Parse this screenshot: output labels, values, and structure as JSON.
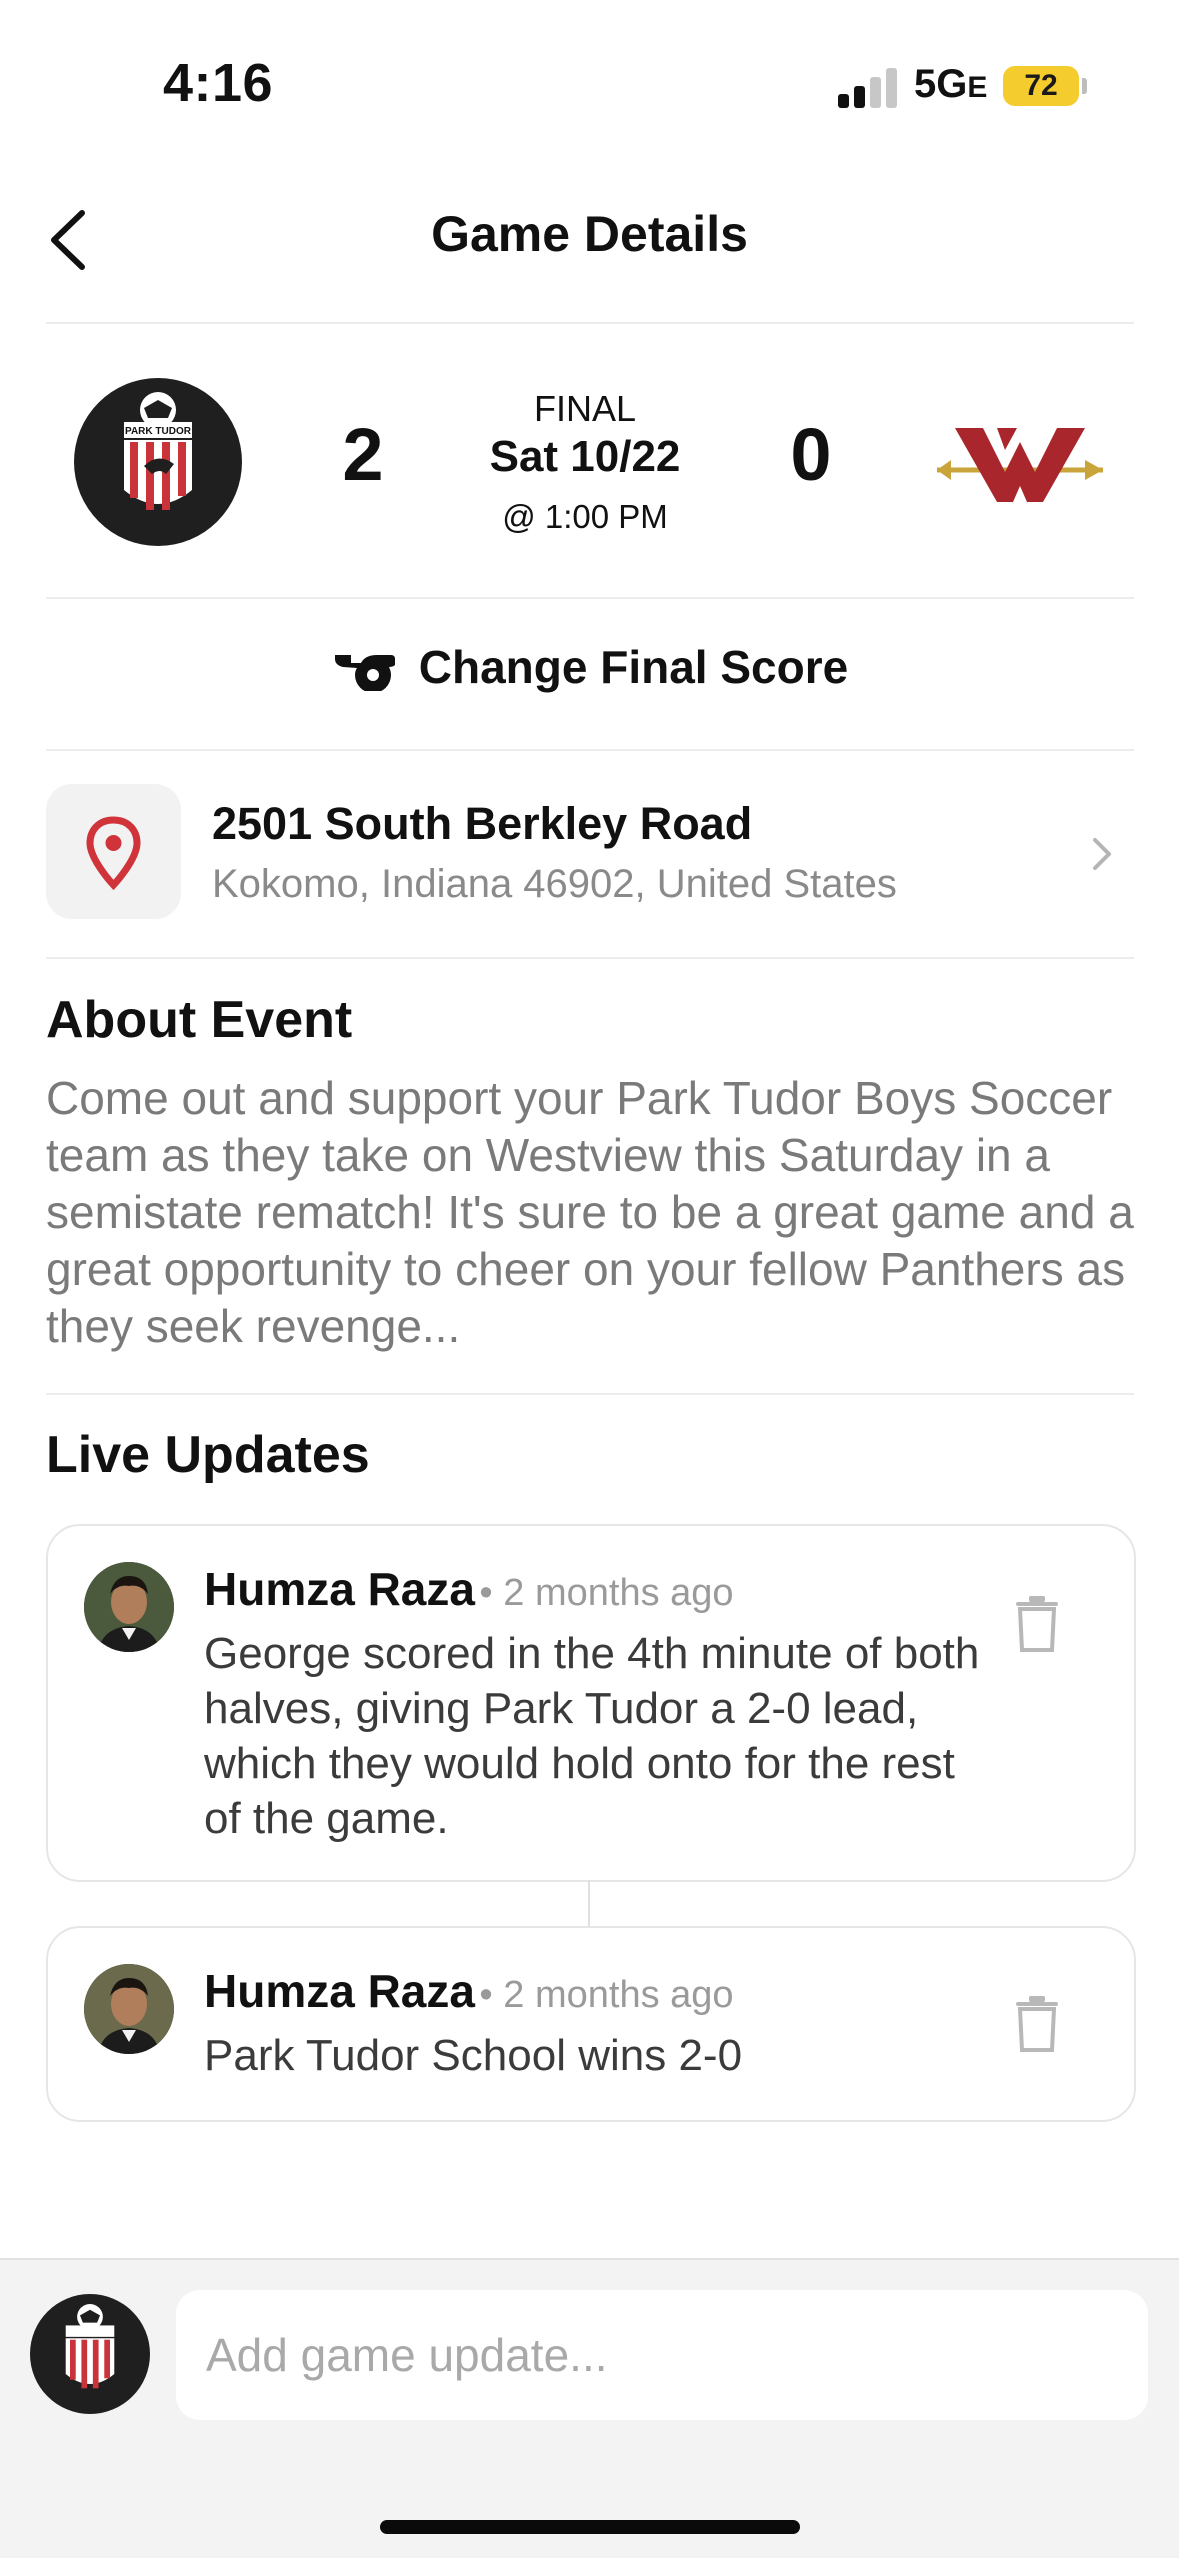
{
  "status_bar": {
    "time": "4:16",
    "network": "5G",
    "network_suffix": "E",
    "battery": "72",
    "battery_color": "#f5cc2e"
  },
  "header": {
    "title": "Game Details",
    "back_icon": "chevron-left-icon"
  },
  "game": {
    "home_team_logo_text": "PARK TUDOR",
    "home_score": "2",
    "away_score": "0",
    "status": "FINAL",
    "date": "Sat 10/22",
    "time": "@ 1:00 PM"
  },
  "change_score": {
    "label": "Change Final Score",
    "icon": "whistle-icon"
  },
  "location": {
    "street": "2501 South Berkley Road",
    "city": "Kokomo, Indiana 46902, United States",
    "icon": "map-pin-icon",
    "pin_color": "#d0343a"
  },
  "about": {
    "heading": "About Event",
    "text": "Come out and support your Park Tudor Boys Soccer team as they take on Westview this Saturday in a semistate rematch! It's sure to be a great game and a great opportunity to cheer on your fellow Panthers as they seek revenge..."
  },
  "updates": {
    "heading": "Live Updates",
    "items": [
      {
        "author": "Humza Raza",
        "time": "• 2 months ago",
        "text": "George scored in the 4th minute of both halves, giving Park Tudor a 2-0 lead, which they would hold onto for the rest of the game."
      },
      {
        "author": "Humza Raza",
        "time": "• 2 months ago",
        "text": "Park Tudor School wins 2-0"
      }
    ]
  },
  "composer": {
    "placeholder": "Add game update..."
  }
}
